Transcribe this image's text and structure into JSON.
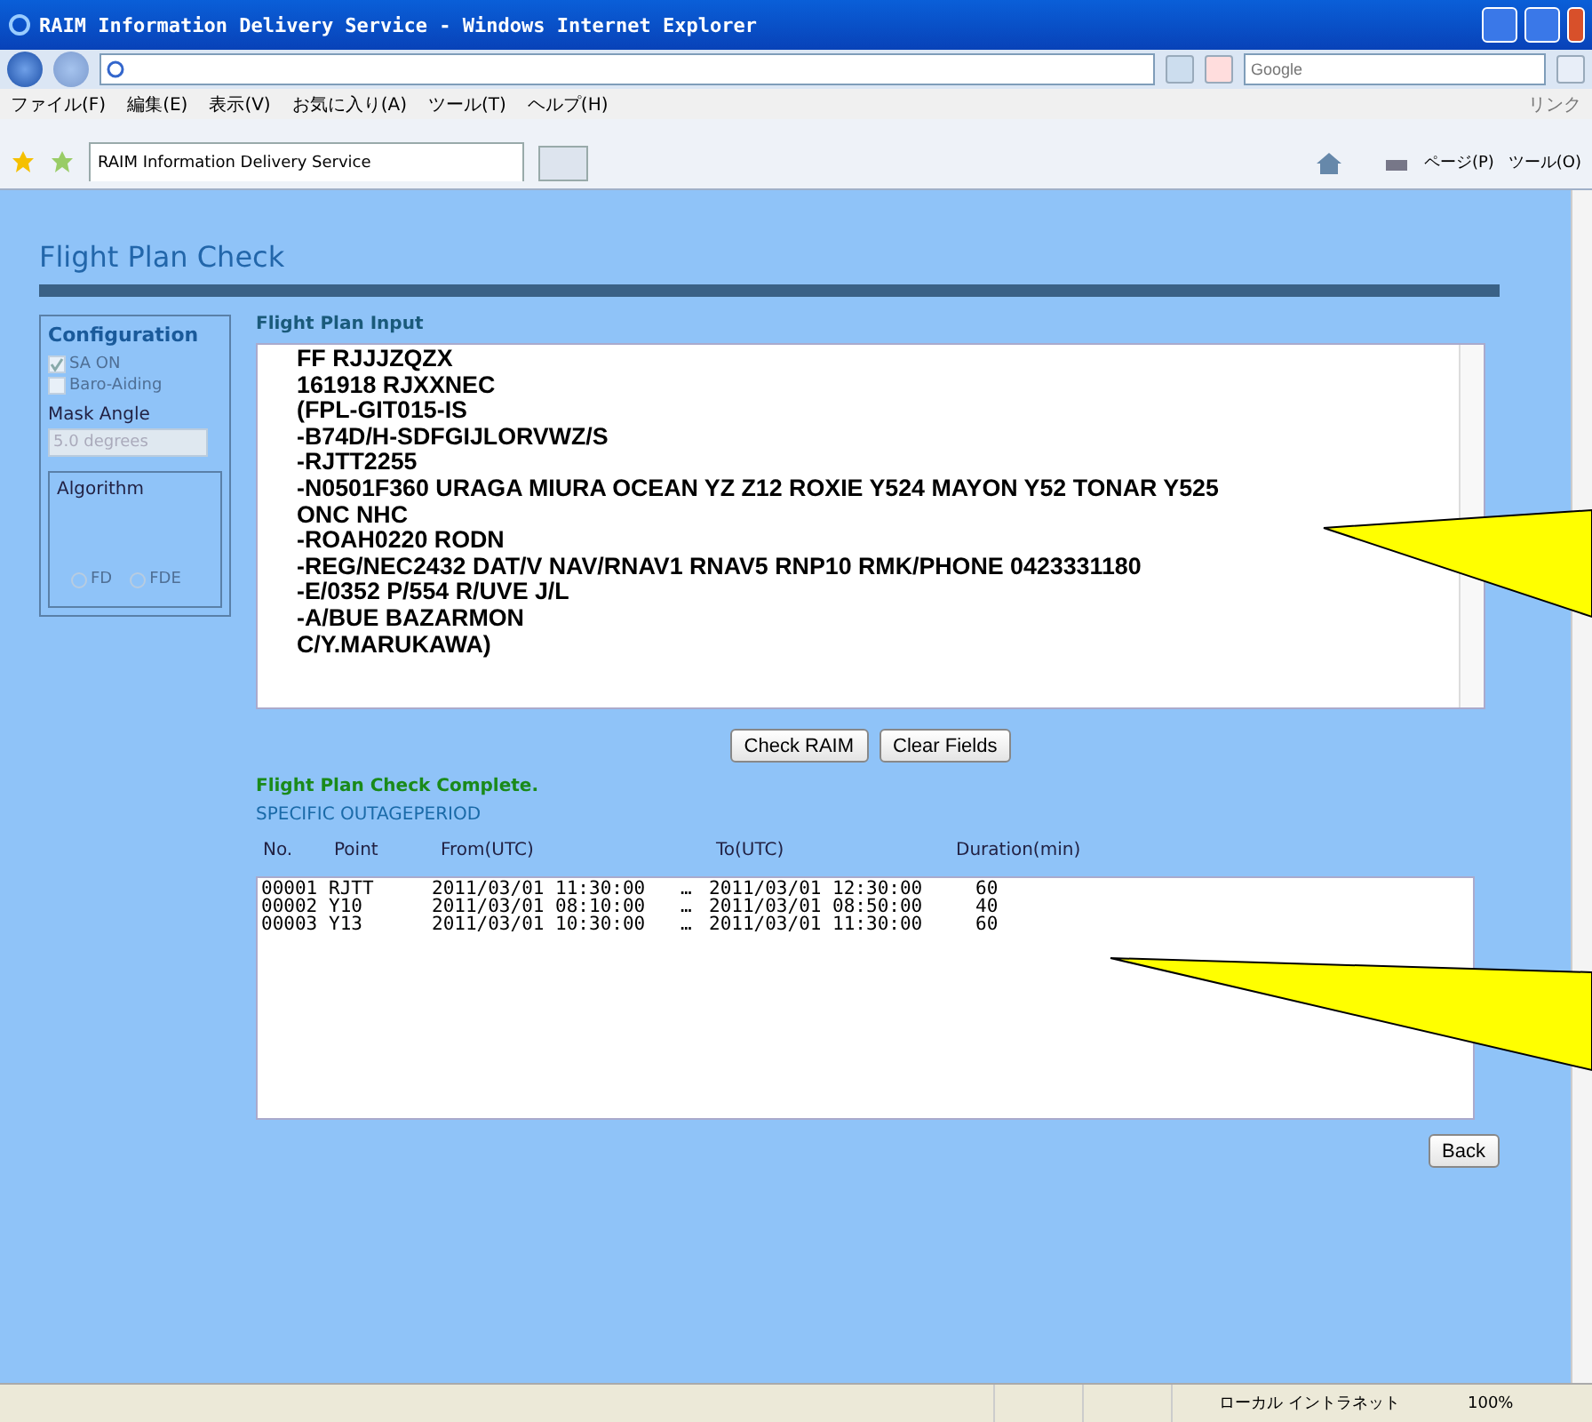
{
  "window": {
    "title": "RAIM Information Delivery Service - Windows Internet Explorer"
  },
  "address_bar": {
    "search_placeholder": "Google"
  },
  "menu": [
    "ファイル(F)",
    "編集(E)",
    "表示(V)",
    "お気に入り(A)",
    "ツール(T)",
    "ヘルプ(H)"
  ],
  "links_label": "リンク",
  "tabs": [
    {
      "label": "RAIM Information Delivery Service",
      "selected": true
    }
  ],
  "toolbar": [
    "ページ(P)",
    "ツール(O)"
  ],
  "page": {
    "title": "Flight Plan Check",
    "configuration": {
      "title": "Configuration",
      "checkboxes": [
        {
          "label": "SA ON",
          "checked": true,
          "disabled": true
        },
        {
          "label": "Baro-Aiding",
          "checked": false,
          "disabled": true
        }
      ],
      "mask_angle": {
        "label": "Mask Angle",
        "value": "5.0 degrees",
        "disabled": true
      },
      "algorithm": {
        "title": "Algorithm",
        "options": [
          {
            "label": "FD",
            "selected": false,
            "disabled": true
          },
          {
            "label": "FDE",
            "selected": false,
            "disabled": true
          }
        ]
      }
    },
    "input": {
      "label": "Flight Plan Input",
      "lines": [
        "FF RJJJZQZX",
        "161918 RJXXNEC",
        "(FPL-GIT015-IS",
        "-B74D/H-SDFGIJLORVWZ/S",
        "-RJTT2255",
        "-N0501F360 URAGA MIURA OCEAN YZ Z12 ROXIE Y524 MAYON Y52 TONAR Y525",
        "ONC NHC",
        "-ROAH0220 RODN",
        "-REG/NEC2432 DAT/V NAV/RNAV1 RNAV5 RNP10 RMK/PHONE 0423331180",
        "-E/0352 P/554 R/UVE J/L",
        "-A/BUE BAZARMON",
        "C/Y.MARUKAWA)"
      ]
    },
    "buttons": [
      "Check RAIM",
      "Clear Fields"
    ],
    "status": "Flight Plan Check Complete.",
    "results_title": "SPECIFIC OUTAGEPERIOD",
    "columns": [
      "No.",
      "Point",
      "From(UTC)",
      "To(UTC)",
      "Duration(min)"
    ],
    "rows": [
      {
        "no": "00001",
        "point": "RJTT",
        "from": "2011/03/01 11:30:00",
        "sep": "…",
        "to": "2011/03/01 12:30:00",
        "duration": "60"
      },
      {
        "no": "00002",
        "point": "Y10",
        "from": "2011/03/01 08:10:00",
        "sep": "…",
        "to": "2011/03/01 08:50:00",
        "duration": "40"
      },
      {
        "no": "00003",
        "point": "Y13",
        "from": "2011/03/01 10:30:00",
        "sep": "…",
        "to": "2011/03/01 11:30:00",
        "duration": "60"
      }
    ],
    "back_button": "Back"
  },
  "status_bar": {
    "zone": "ローカル イントラネット",
    "zoom": "100%"
  }
}
